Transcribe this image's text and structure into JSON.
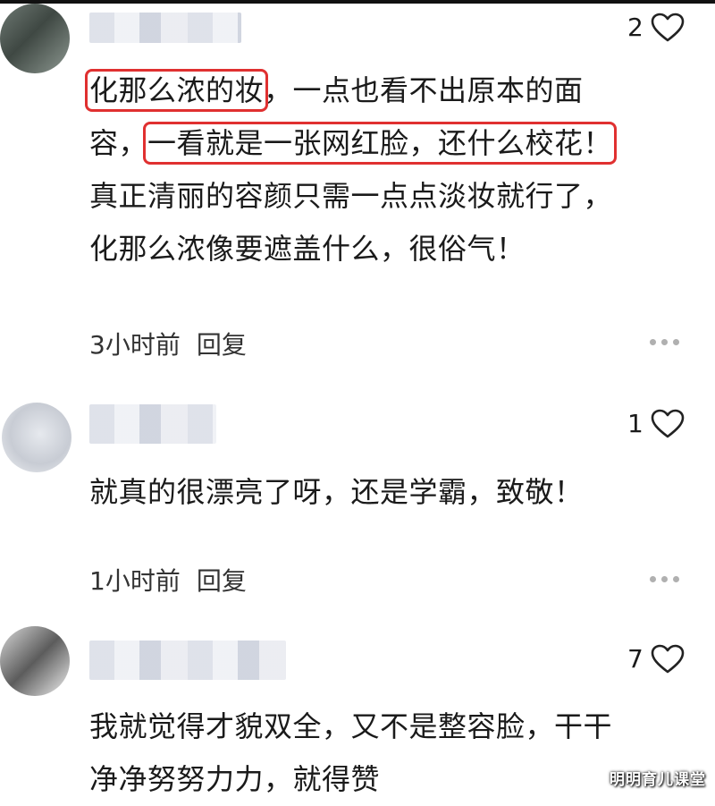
{
  "comments": [
    {
      "likes": "2",
      "lines": [
        [
          "化那么浓的妆",
          "，一点也看不出原本的面"
        ],
        [
          "容，",
          "一看就是一张网红脸，还什么校花！"
        ],
        [
          "真正清丽的容颜只需一点点淡妆就行了，"
        ],
        [
          "化那么浓像要遮盖什么，很俗气！"
        ]
      ],
      "time": "3小时前",
      "reply": "回复"
    },
    {
      "likes": "1",
      "lines": [
        [
          "就真的很漂亮了呀，还是学霸，致敬！"
        ]
      ],
      "time": "1小时前",
      "reply": "回复"
    },
    {
      "likes": "7",
      "lines": [
        [
          "我就觉得才貌双全，又不是整容脸，干干"
        ],
        [
          "净净努努力力，就得赞"
        ]
      ]
    }
  ],
  "watermark": "明明育儿课堂",
  "icons": {
    "like": "heart-outline-icon",
    "more": "more-dots-icon"
  },
  "colors": {
    "highlight_box": "#e03030",
    "text": "#1a1a1a",
    "meta": "#333333"
  }
}
